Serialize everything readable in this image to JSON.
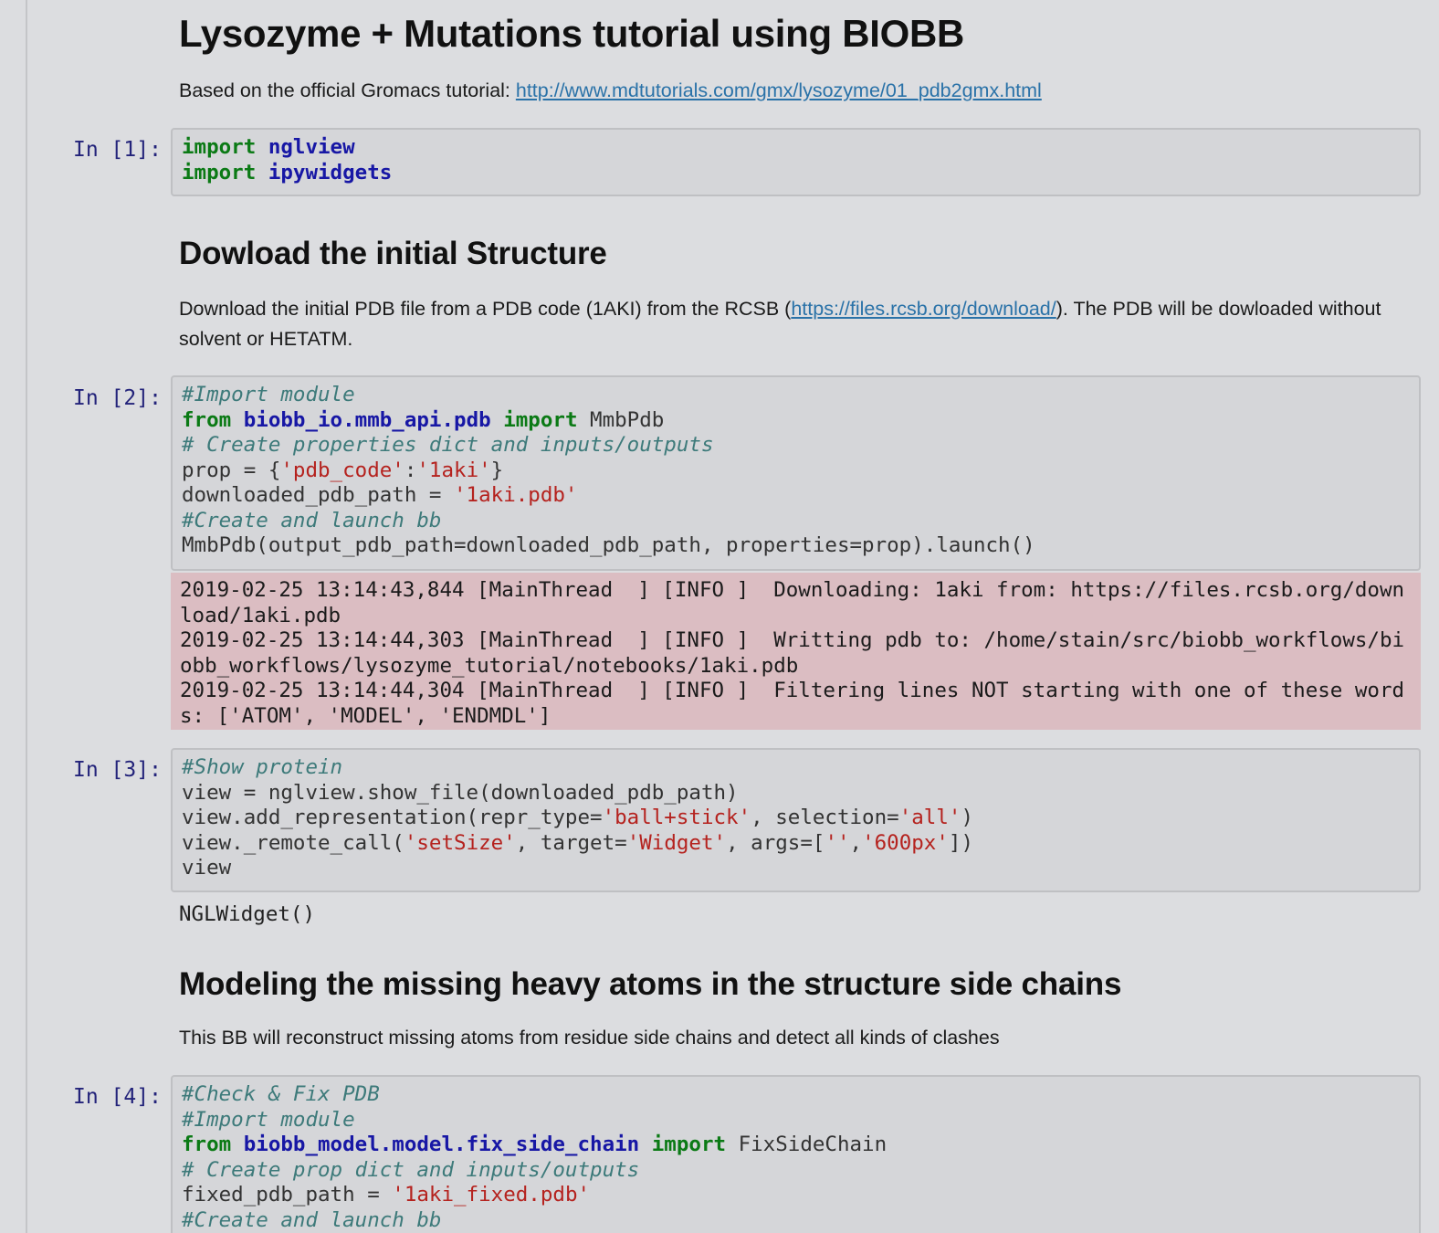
{
  "title": "Lysozyme + Mutations tutorial using BIOBB",
  "intro": {
    "text": "Based on the official Gromacs tutorial: ",
    "link": "http://www.mdtutorials.com/gmx/lysozyme/01_pdb2gmx.html"
  },
  "cells": {
    "c1": {
      "prompt": "In [1]:",
      "lines": [
        [
          {
            "t": "import",
            "c": "k"
          },
          {
            "t": " "
          },
          {
            "t": "nglview",
            "c": "nn"
          }
        ],
        [
          {
            "t": "import",
            "c": "k"
          },
          {
            "t": " "
          },
          {
            "t": "ipywidgets",
            "c": "nn"
          }
        ]
      ]
    },
    "c2": {
      "prompt": "In [2]:",
      "lines": [
        [
          {
            "t": "#Import module",
            "c": "c"
          }
        ],
        [
          {
            "t": "from",
            "c": "k"
          },
          {
            "t": " "
          },
          {
            "t": "biobb_io.mmb_api.pdb",
            "c": "nn"
          },
          {
            "t": " "
          },
          {
            "t": "import",
            "c": "k"
          },
          {
            "t": " MmbPdb"
          }
        ],
        [
          {
            "t": "# Create properties dict and inputs/outputs",
            "c": "c"
          }
        ],
        [
          {
            "t": "prop = {"
          },
          {
            "t": "'pdb_code'",
            "c": "s"
          },
          {
            "t": ":"
          },
          {
            "t": "'1aki'",
            "c": "s"
          },
          {
            "t": "}"
          }
        ],
        [
          {
            "t": "downloaded_pdb_path = "
          },
          {
            "t": "'1aki.pdb'",
            "c": "s"
          }
        ],
        [
          {
            "t": "#Create and launch bb",
            "c": "c"
          }
        ],
        [
          {
            "t": "MmbPdb(output_pdb_path=downloaded_pdb_path, properties=prop).launch()"
          }
        ]
      ],
      "stderr": "2019-02-25 13:14:43,844 [MainThread  ] [INFO ]  Downloading: 1aki from: https://files.rcsb.org/download/1aki.pdb\n2019-02-25 13:14:44,303 [MainThread  ] [INFO ]  Writting pdb to: /home/stain/src/biobb_workflows/biobb_workflows/lysozyme_tutorial/notebooks/1aki.pdb\n2019-02-25 13:14:44,304 [MainThread  ] [INFO ]  Filtering lines NOT starting with one of these words: ['ATOM', 'MODEL', 'ENDMDL']"
    },
    "c3": {
      "prompt": "In [3]:",
      "lines": [
        [
          {
            "t": "#Show protein",
            "c": "c"
          }
        ],
        [
          {
            "t": "view = nglview.show_file(downloaded_pdb_path)"
          }
        ],
        [
          {
            "t": "view.add_representation(repr_type="
          },
          {
            "t": "'ball+stick'",
            "c": "s"
          },
          {
            "t": ", selection="
          },
          {
            "t": "'all'",
            "c": "s"
          },
          {
            "t": ")"
          }
        ],
        [
          {
            "t": "view._remote_call("
          },
          {
            "t": "'setSize'",
            "c": "s"
          },
          {
            "t": ", target="
          },
          {
            "t": "'Widget'",
            "c": "s"
          },
          {
            "t": ", args=["
          },
          {
            "t": "''",
            "c": "s"
          },
          {
            "t": ","
          },
          {
            "t": "'600px'",
            "c": "s"
          },
          {
            "t": "])"
          }
        ],
        [
          {
            "t": "view"
          }
        ]
      ],
      "output": "NGLWidget()"
    },
    "c4": {
      "prompt": "In [4]:",
      "lines": [
        [
          {
            "t": "#Check & Fix PDB",
            "c": "c"
          }
        ],
        [
          {
            "t": "#Import module",
            "c": "c"
          }
        ],
        [
          {
            "t": "from",
            "c": "k"
          },
          {
            "t": " "
          },
          {
            "t": "biobb_model.model.fix_side_chain",
            "c": "nn"
          },
          {
            "t": " "
          },
          {
            "t": "import",
            "c": "k"
          },
          {
            "t": " FixSideChain"
          }
        ],
        [
          {
            "t": "# Create prop dict and inputs/outputs",
            "c": "c"
          }
        ],
        [
          {
            "t": "fixed_pdb_path = "
          },
          {
            "t": "'1aki_fixed.pdb'",
            "c": "s"
          }
        ],
        [
          {
            "t": "#Create and launch bb",
            "c": "c"
          }
        ]
      ]
    }
  },
  "section1": {
    "heading": "Dowload the initial Structure",
    "text_before": "Download the initial PDB file from a PDB code (1AKI) from the RCSB (",
    "link": "https://files.rcsb.org/download/",
    "text_after": "). The PDB will be dowloaded without solvent or HETATM."
  },
  "section2": {
    "heading": "Modeling the missing heavy atoms in the structure side chains",
    "text": "This BB will reconstruct missing atoms from residue side chains and detect all kinds of clashes"
  }
}
